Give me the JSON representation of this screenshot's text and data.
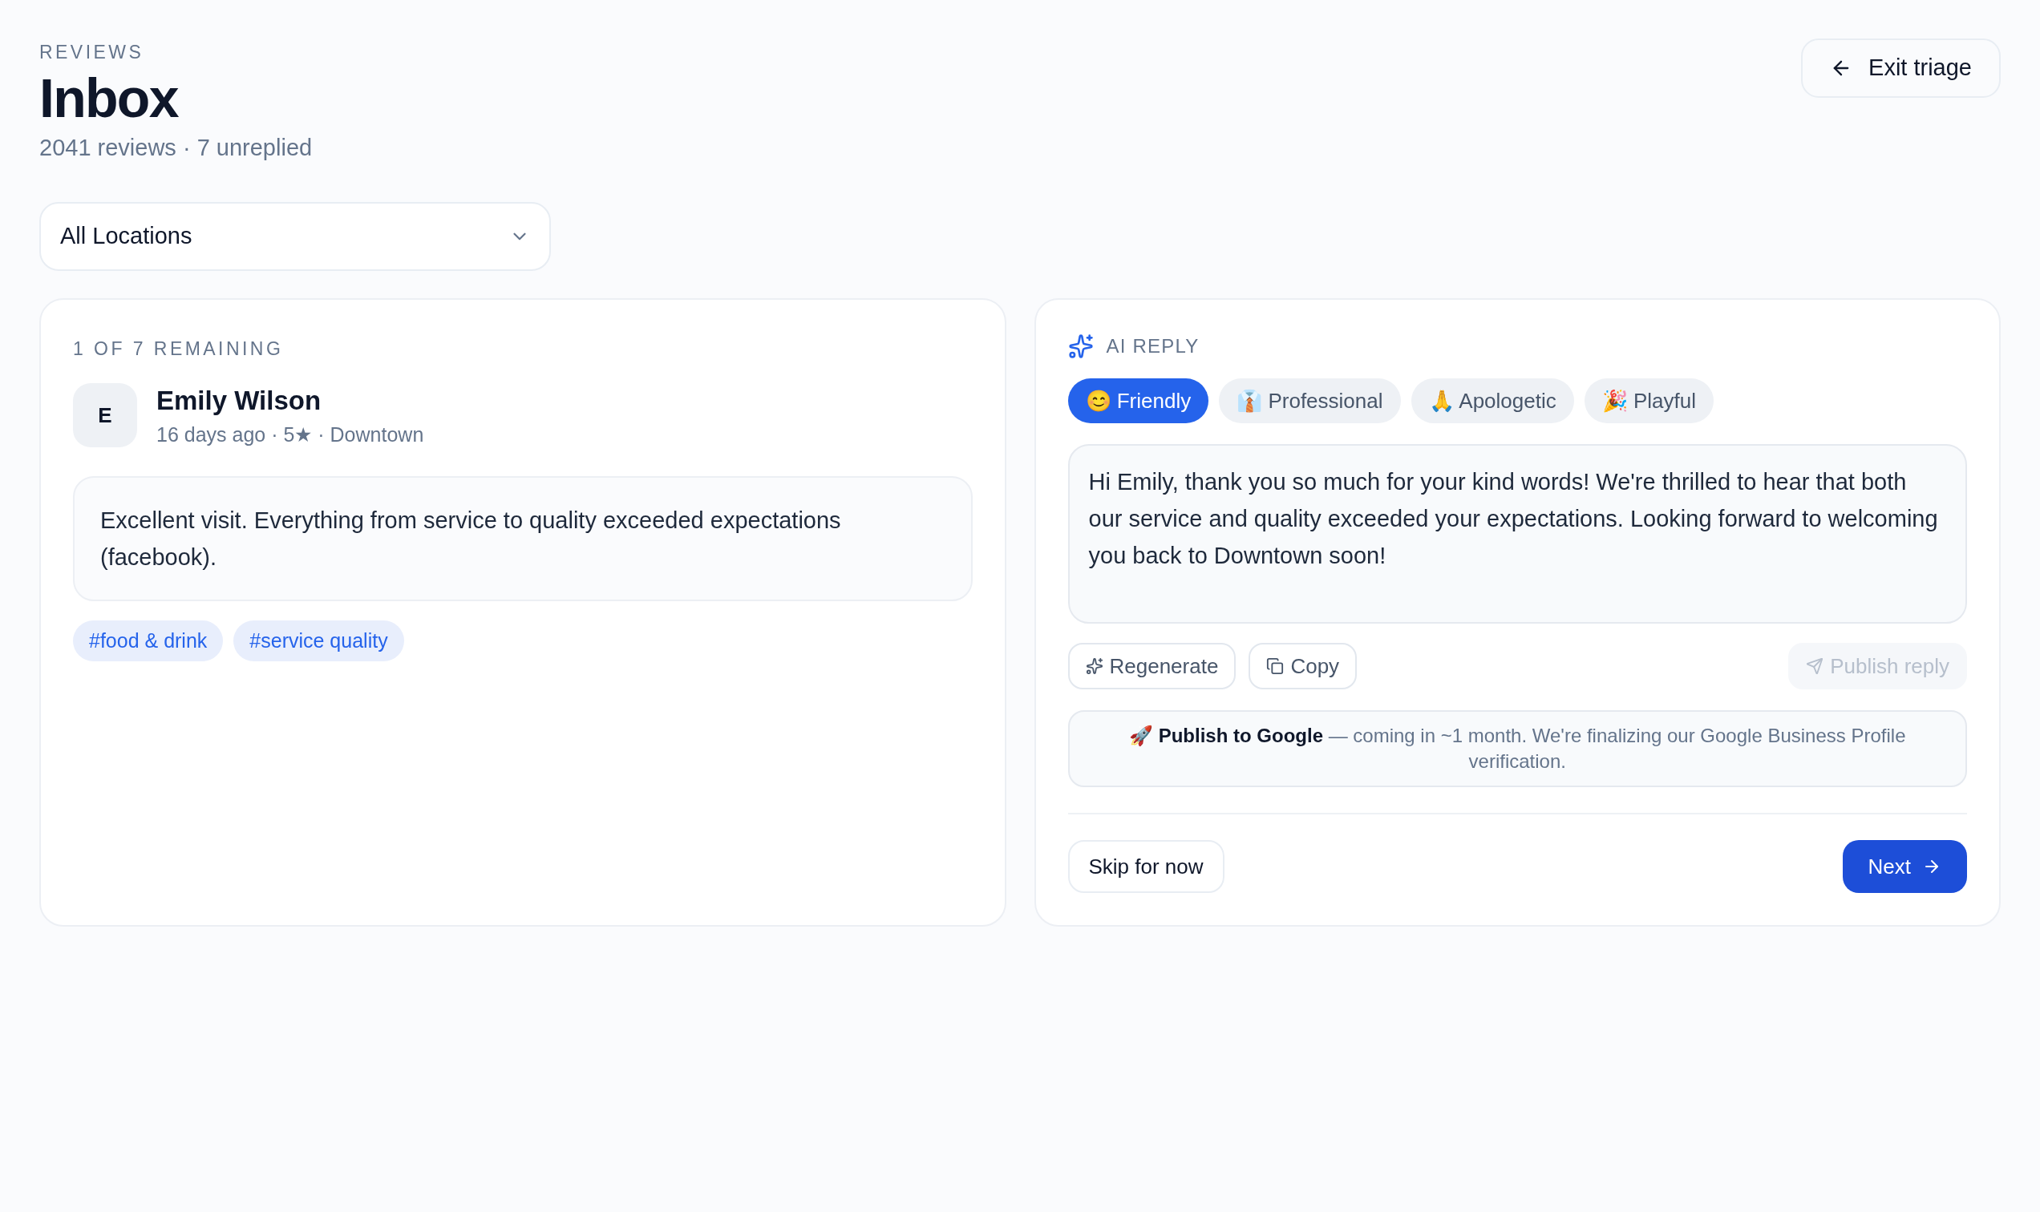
{
  "header": {
    "eyebrow": "REVIEWS",
    "title": "Inbox",
    "subtitle": "2041 reviews · 7 unreplied",
    "exit_button": "Exit triage"
  },
  "location_select": {
    "value": "All Locations"
  },
  "review": {
    "progress": "1 OF 7 REMAINING",
    "avatar": "E",
    "author": "Emily Wilson",
    "meta": "16 days ago · 5★ · Downtown",
    "text": "Excellent visit. Everything from service to quality exceeded expectations (facebook).",
    "tags": [
      "#food & drink",
      "#service quality"
    ]
  },
  "ai_reply": {
    "heading": "AI REPLY",
    "tones": [
      {
        "label": "😊 Friendly",
        "selected": true
      },
      {
        "label": "👔 Professional",
        "selected": false
      },
      {
        "label": "🙏 Apologetic",
        "selected": false
      },
      {
        "label": "🎉 Playful",
        "selected": false
      }
    ],
    "reply_text": "Hi Emily, thank you so much for your kind words! We're thrilled to hear that both our service and quality exceeded your expectations. Looking forward to welcoming you back to Downtown soon!",
    "actions": [
      {
        "kind": "regenerate",
        "label": "Regenerate",
        "disabled": false
      },
      {
        "kind": "copy",
        "label": "Copy",
        "disabled": false
      },
      {
        "kind": "publish",
        "label": "Publish reply",
        "disabled": true
      }
    ],
    "notice": "🚀 **Publish to Google** — coming in ~1 month. We're finalizing our Google Business Profile verification.",
    "skip_button": "Skip for now",
    "next_button": "Next"
  }
}
